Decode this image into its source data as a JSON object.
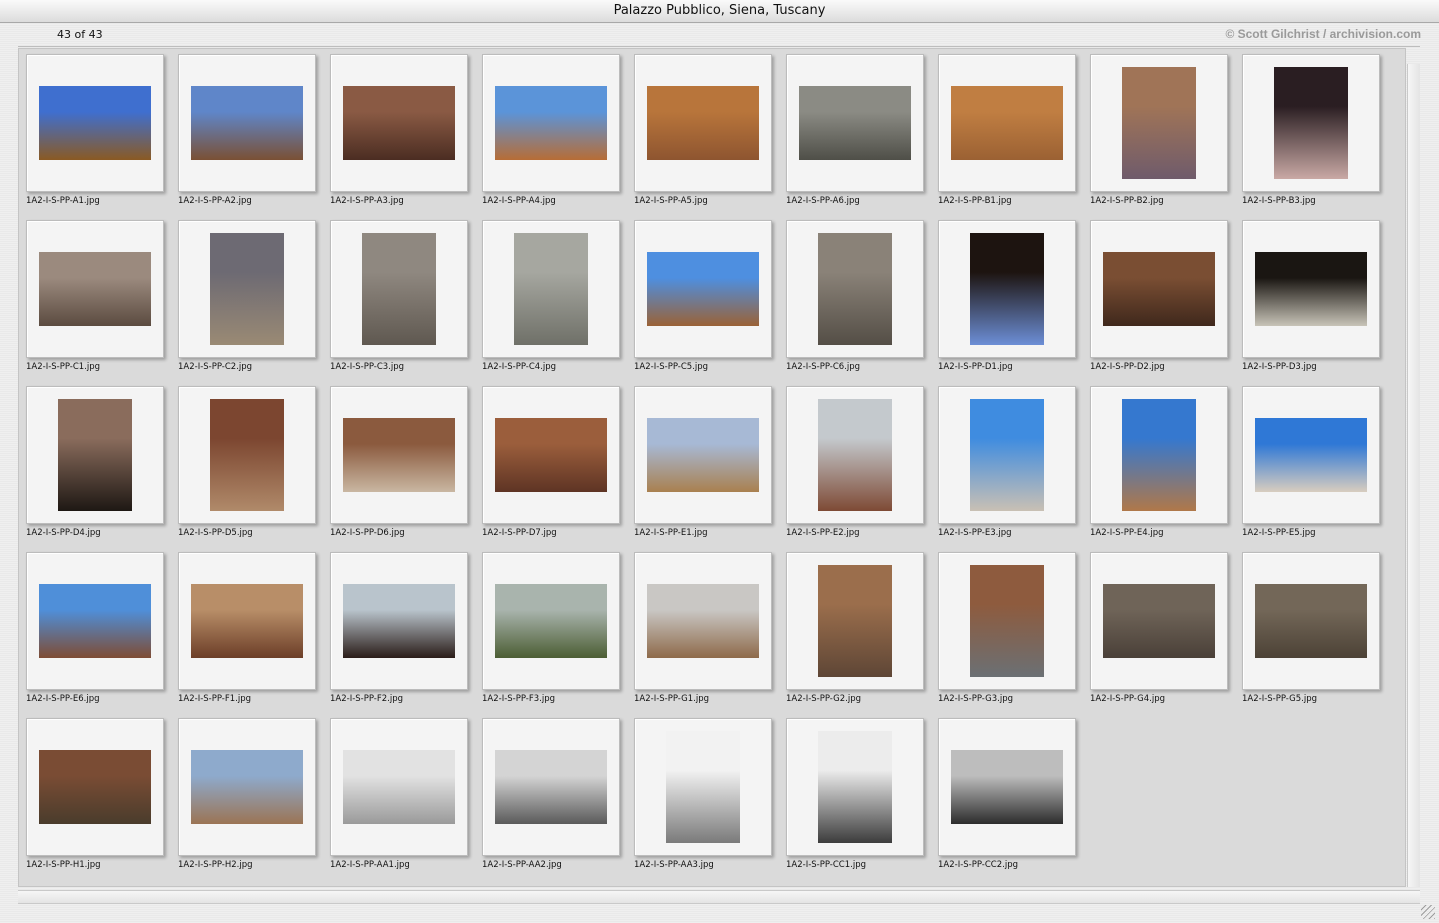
{
  "window": {
    "title": "Palazzo Pubblico, Siena, Tuscany"
  },
  "header": {
    "counter": "43 of 43",
    "copyright": "© Scott Gilchrist / archivision.com"
  },
  "thumbnails": [
    {
      "file": "1A2-I-S-PP-A1.jpg",
      "orient": "landscape",
      "colors": [
        "#3f6fcf",
        "#8a5a23"
      ]
    },
    {
      "file": "1A2-I-S-PP-A2.jpg",
      "orient": "landscape",
      "colors": [
        "#5f86c9",
        "#7a5034"
      ]
    },
    {
      "file": "1A2-I-S-PP-A3.jpg",
      "orient": "landscape",
      "colors": [
        "#8a5a44",
        "#4b2d22"
      ]
    },
    {
      "file": "1A2-I-S-PP-A4.jpg",
      "orient": "landscape",
      "colors": [
        "#5b94d9",
        "#b76d36"
      ]
    },
    {
      "file": "1A2-I-S-PP-A5.jpg",
      "orient": "landscape",
      "colors": [
        "#b8753b",
        "#8e5530"
      ]
    },
    {
      "file": "1A2-I-S-PP-A6.jpg",
      "orient": "landscape",
      "colors": [
        "#8b8b84",
        "#4f4f48"
      ]
    },
    {
      "file": "1A2-I-S-PP-B1.jpg",
      "orient": "landscape",
      "colors": [
        "#c07e42",
        "#9b6133"
      ]
    },
    {
      "file": "1A2-I-S-PP-B2.jpg",
      "orient": "portrait",
      "colors": [
        "#a07457",
        "#6f5b6b"
      ]
    },
    {
      "file": "1A2-I-S-PP-B3.jpg",
      "orient": "portrait",
      "colors": [
        "#2a1e22",
        "#c9a9a5"
      ]
    },
    {
      "file": "1A2-I-S-PP-C1.jpg",
      "orient": "landscape",
      "colors": [
        "#9b8a7e",
        "#5b4b40"
      ]
    },
    {
      "file": "1A2-I-S-PP-C2.jpg",
      "orient": "portrait",
      "colors": [
        "#6d6a73",
        "#9a8a74"
      ]
    },
    {
      "file": "1A2-I-S-PP-C3.jpg",
      "orient": "portrait",
      "colors": [
        "#8f8880",
        "#5f5850"
      ]
    },
    {
      "file": "1A2-I-S-PP-C4.jpg",
      "orient": "portrait",
      "colors": [
        "#a6a7a0",
        "#6f7068"
      ]
    },
    {
      "file": "1A2-I-S-PP-C5.jpg",
      "orient": "landscape",
      "colors": [
        "#4e8fe0",
        "#9a6236"
      ]
    },
    {
      "file": "1A2-I-S-PP-C6.jpg",
      "orient": "portrait",
      "colors": [
        "#8a8278",
        "#544e46"
      ]
    },
    {
      "file": "1A2-I-S-PP-D1.jpg",
      "orient": "portrait",
      "colors": [
        "#1d1410",
        "#6c8ed6"
      ]
    },
    {
      "file": "1A2-I-S-PP-D2.jpg",
      "orient": "landscape",
      "colors": [
        "#7a4e33",
        "#3f281c"
      ]
    },
    {
      "file": "1A2-I-S-PP-D3.jpg",
      "orient": "landscape",
      "colors": [
        "#1a1612",
        "#c8c4b8"
      ]
    },
    {
      "file": "1A2-I-S-PP-D4.jpg",
      "orient": "portrait",
      "colors": [
        "#8a6c5c",
        "#1e1814"
      ]
    },
    {
      "file": "1A2-I-S-PP-D5.jpg",
      "orient": "portrait",
      "colors": [
        "#7c4630",
        "#b08a6a"
      ]
    },
    {
      "file": "1A2-I-S-PP-D6.jpg",
      "orient": "landscape",
      "colors": [
        "#8b5a3e",
        "#c9b7a2"
      ]
    },
    {
      "file": "1A2-I-S-PP-D7.jpg",
      "orient": "landscape",
      "colors": [
        "#9b5e3c",
        "#5e3424"
      ]
    },
    {
      "file": "1A2-I-S-PP-E1.jpg",
      "orient": "landscape",
      "colors": [
        "#a7b9d5",
        "#a9804f"
      ]
    },
    {
      "file": "1A2-I-S-PP-E2.jpg",
      "orient": "portrait",
      "colors": [
        "#c4c9cd",
        "#7e4a35"
      ]
    },
    {
      "file": "1A2-I-S-PP-E3.jpg",
      "orient": "portrait",
      "colors": [
        "#3f8ce0",
        "#c9c0b4"
      ]
    },
    {
      "file": "1A2-I-S-PP-E4.jpg",
      "orient": "portrait",
      "colors": [
        "#3578cf",
        "#b07849"
      ]
    },
    {
      "file": "1A2-I-S-PP-E5.jpg",
      "orient": "landscape",
      "colors": [
        "#2f78d6",
        "#d8cdbf"
      ]
    },
    {
      "file": "1A2-I-S-PP-E6.jpg",
      "orient": "landscape",
      "colors": [
        "#4f8fd9",
        "#7e4c34"
      ]
    },
    {
      "file": "1A2-I-S-PP-F1.jpg",
      "orient": "landscape",
      "colors": [
        "#b88e68",
        "#6c3e28"
      ]
    },
    {
      "file": "1A2-I-S-PP-F2.jpg",
      "orient": "landscape",
      "colors": [
        "#b9c4cc",
        "#2a1c18"
      ]
    },
    {
      "file": "1A2-I-S-PP-F3.jpg",
      "orient": "landscape",
      "colors": [
        "#a9b4ad",
        "#4c5e34"
      ]
    },
    {
      "file": "1A2-I-S-PP-G1.jpg",
      "orient": "landscape",
      "colors": [
        "#c9c7c4",
        "#8e6a4a"
      ]
    },
    {
      "file": "1A2-I-S-PP-G2.jpg",
      "orient": "portrait",
      "colors": [
        "#9b6e4c",
        "#5e4636"
      ]
    },
    {
      "file": "1A2-I-S-PP-G3.jpg",
      "orient": "portrait",
      "colors": [
        "#8e5b3e",
        "#6b7074"
      ]
    },
    {
      "file": "1A2-I-S-PP-G4.jpg",
      "orient": "landscape",
      "colors": [
        "#6f6458",
        "#4a4038"
      ]
    },
    {
      "file": "1A2-I-S-PP-G5.jpg",
      "orient": "landscape",
      "colors": [
        "#736758",
        "#4c4236"
      ]
    },
    {
      "file": "1A2-I-S-PP-H1.jpg",
      "orient": "landscape",
      "colors": [
        "#7a4c34",
        "#4a3c2c"
      ]
    },
    {
      "file": "1A2-I-S-PP-H2.jpg",
      "orient": "landscape",
      "colors": [
        "#8eaacc",
        "#9b7454"
      ]
    },
    {
      "file": "1A2-I-S-PP-AA1.jpg",
      "orient": "landscape",
      "colors": [
        "#e2e2e2",
        "#9a9a9a"
      ]
    },
    {
      "file": "1A2-I-S-PP-AA2.jpg",
      "orient": "landscape",
      "colors": [
        "#d4d4d4",
        "#5a5a5a"
      ]
    },
    {
      "file": "1A2-I-S-PP-AA3.jpg",
      "orient": "portrait",
      "colors": [
        "#f2f2f2",
        "#7a7a7a"
      ]
    },
    {
      "file": "1A2-I-S-PP-CC1.jpg",
      "orient": "portrait",
      "colors": [
        "#ececec",
        "#3c3c3c"
      ]
    },
    {
      "file": "1A2-I-S-PP-CC2.jpg",
      "orient": "landscape",
      "colors": [
        "#bdbdbd",
        "#2c2c2c"
      ]
    }
  ]
}
